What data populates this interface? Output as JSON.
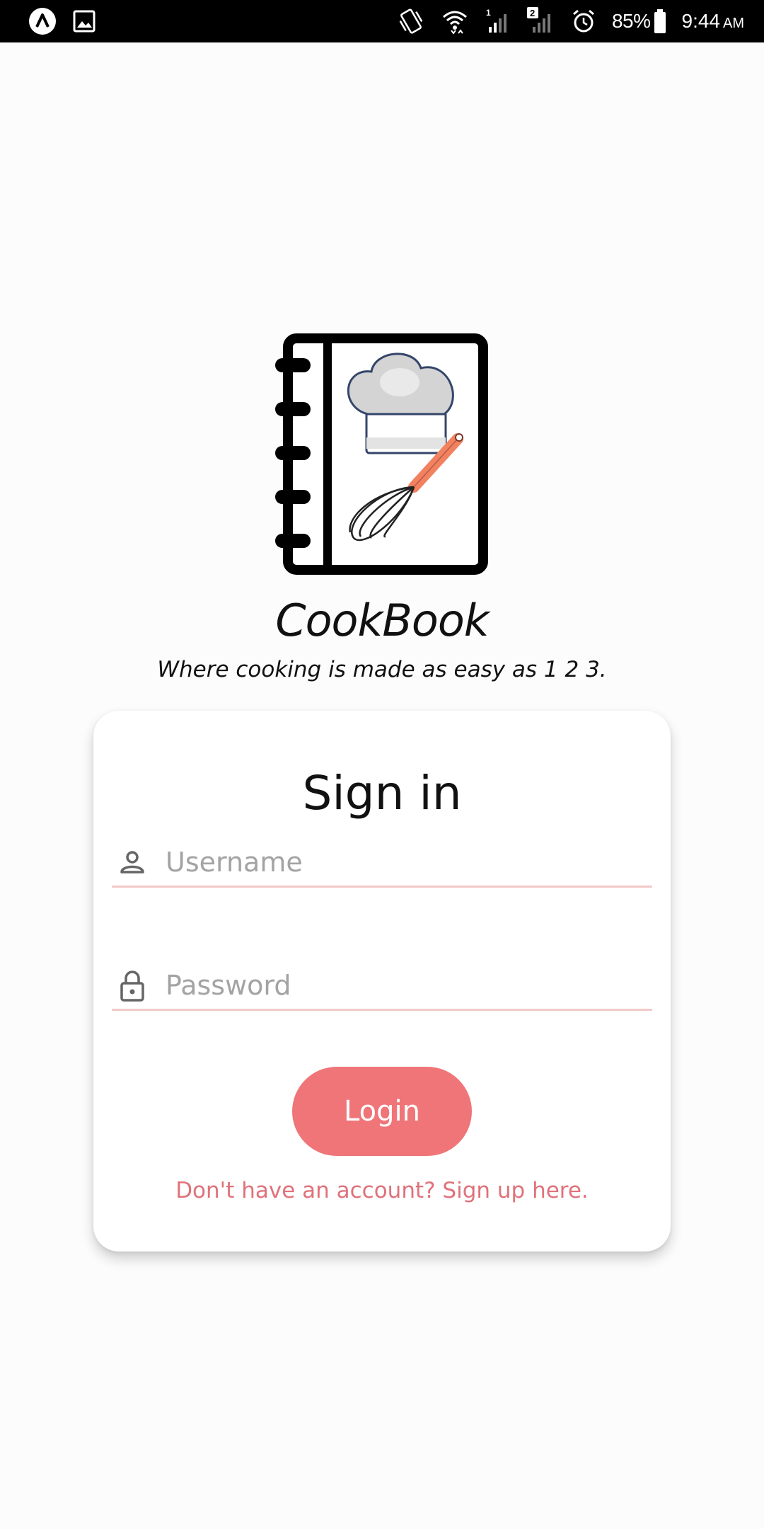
{
  "status_bar": {
    "battery_percent": "85%",
    "time": "9:44",
    "ampm": "AM",
    "sim1_label": "1",
    "sim2_label": "2"
  },
  "app": {
    "title": "CookBook",
    "tagline": "Where cooking is made as easy as 1 2 3."
  },
  "signin": {
    "heading": "Sign in",
    "username_placeholder": "Username",
    "password_placeholder": "Password",
    "login_label": "Login",
    "signup_text": "Don't have an account? Sign up here."
  },
  "colors": {
    "accent": "#ef7579",
    "link": "#e0727a",
    "underline": "#f2c9c9"
  }
}
